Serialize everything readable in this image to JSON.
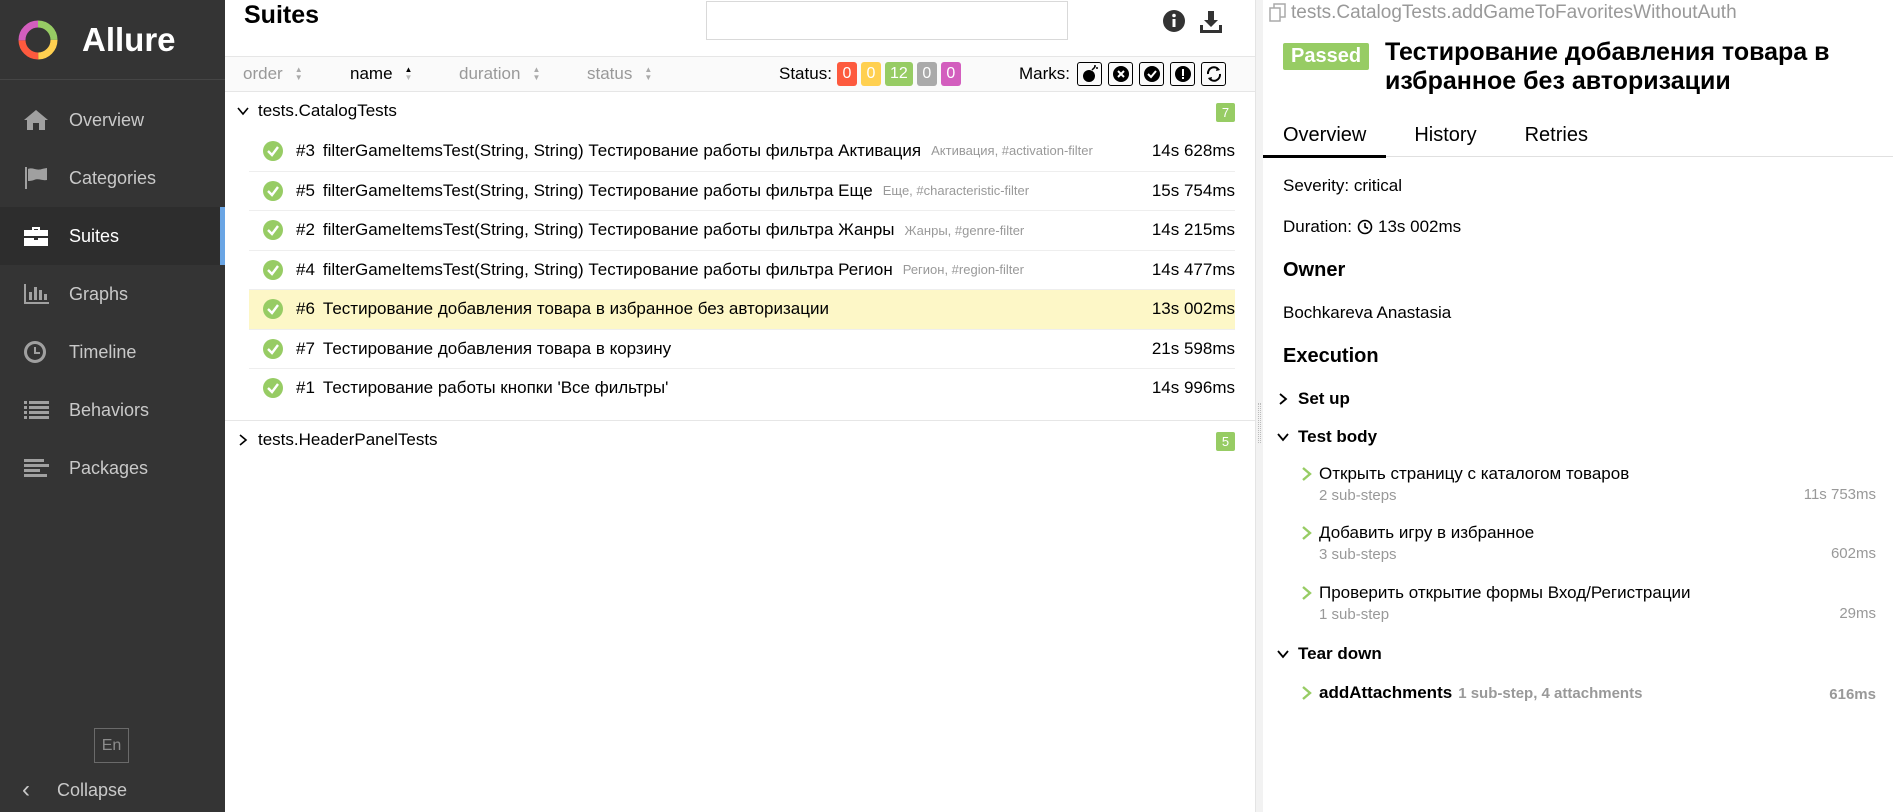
{
  "app": {
    "name": "Allure"
  },
  "sidebar": {
    "items": [
      {
        "label": "Overview",
        "icon": "home-icon"
      },
      {
        "label": "Categories",
        "icon": "flag-icon"
      },
      {
        "label": "Suites",
        "icon": "briefcase-icon",
        "active": true
      },
      {
        "label": "Graphs",
        "icon": "bar-chart-icon"
      },
      {
        "label": "Timeline",
        "icon": "clock-icon"
      },
      {
        "label": "Behaviors",
        "icon": "list-icon"
      },
      {
        "label": "Packages",
        "icon": "align-left-icon"
      }
    ],
    "language": "En",
    "collapse_label": "Collapse"
  },
  "suites": {
    "title": "Suites",
    "search": {
      "value": "",
      "placeholder": ""
    },
    "sort": {
      "order": "order",
      "name": "name",
      "duration": "duration",
      "status": "status",
      "active": "name"
    },
    "status_label": "Status:",
    "status_counts": [
      {
        "value": "0",
        "color": "#fd5a3e"
      },
      {
        "value": "0",
        "color": "#ffd050"
      },
      {
        "value": "12",
        "color": "#97cc64"
      },
      {
        "value": "0",
        "color": "#aaaaaa"
      },
      {
        "value": "0",
        "color": "#d35ebe"
      }
    ],
    "marks_label": "Marks:",
    "groups": [
      {
        "name": "tests.CatalogTests",
        "count": "7",
        "expanded": true,
        "tests": [
          {
            "num": "#3",
            "name": "filterGameItemsTest(String, String) Тестирование работы фильтра Активация",
            "tags": "Активация, #activation-filter",
            "duration": "14s 628ms"
          },
          {
            "num": "#5",
            "name": "filterGameItemsTest(String, String) Тестирование работы фильтра Еще",
            "tags": "Еще, #characteristic-filter",
            "duration": "15s 754ms"
          },
          {
            "num": "#2",
            "name": "filterGameItemsTest(String, String) Тестирование работы фильтра Жанры",
            "tags": "Жанры, #genre-filter",
            "duration": "14s 215ms"
          },
          {
            "num": "#4",
            "name": "filterGameItemsTest(String, String) Тестирование работы фильтра Регион",
            "tags": "Регион, #region-filter",
            "duration": "14s 477ms"
          },
          {
            "num": "#6",
            "name": "Тестирование добавления товара в избранное без авторизации",
            "tags": "",
            "duration": "13s 002ms",
            "selected": true
          },
          {
            "num": "#7",
            "name": "Тестирование добавления товара в корзину",
            "tags": "",
            "duration": "21s 598ms"
          },
          {
            "num": "#1",
            "name": "Тестирование работы кнопки 'Все фильтры'",
            "tags": "",
            "duration": "14s 996ms"
          }
        ]
      },
      {
        "name": "tests.HeaderPanelTests",
        "count": "5",
        "expanded": false
      }
    ]
  },
  "detail": {
    "full_name": "tests.CatalogTests.addGameToFavoritesWithoutAuth",
    "status": "Passed",
    "status_color": "#97cc64",
    "title": "Тестирование добавления товара в избранное без авторизации",
    "tabs": [
      "Overview",
      "History",
      "Retries"
    ],
    "severity": "Severity: critical",
    "duration_label": "Duration:",
    "duration_value": "13s 002ms",
    "owner_heading": "Owner",
    "owner": "Bochkareva Anastasia",
    "execution_heading": "Execution",
    "setup_label": "Set up",
    "body_label": "Test body",
    "teardown_label": "Tear down",
    "steps": [
      {
        "name": "Открыть страницу с каталогом товаров",
        "meta": "2 sub-steps",
        "duration": "11s 753ms"
      },
      {
        "name": "Добавить игру в избранное",
        "meta": "3 sub-steps",
        "duration": "602ms"
      },
      {
        "name": "Проверить открытие формы Вход/Регистрации",
        "meta": "1 sub-step",
        "duration": "29ms"
      }
    ],
    "teardown_step": {
      "name": "addAttachments",
      "meta": "1 sub-step, 4 attachments",
      "duration": "616ms"
    }
  }
}
